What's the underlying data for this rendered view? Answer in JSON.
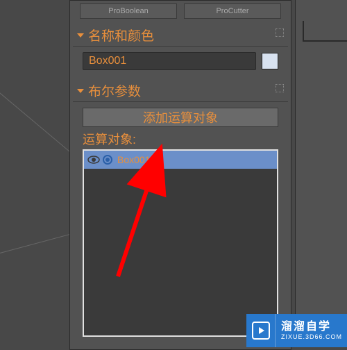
{
  "topButtons": {
    "left": "ProBoolean",
    "right": "ProCutter"
  },
  "sections": {
    "nameColor": {
      "title": "名称和颜色",
      "nameValue": "Box001"
    },
    "boolParams": {
      "title": "布尔参数",
      "addButtonLabel": "添加运算对象",
      "listLabel": "运算对象:",
      "items": [
        {
          "name": "Box001"
        }
      ]
    }
  },
  "watermark": {
    "main": "溜溜自学",
    "sub": "ZIXUE.3D66.COM"
  }
}
